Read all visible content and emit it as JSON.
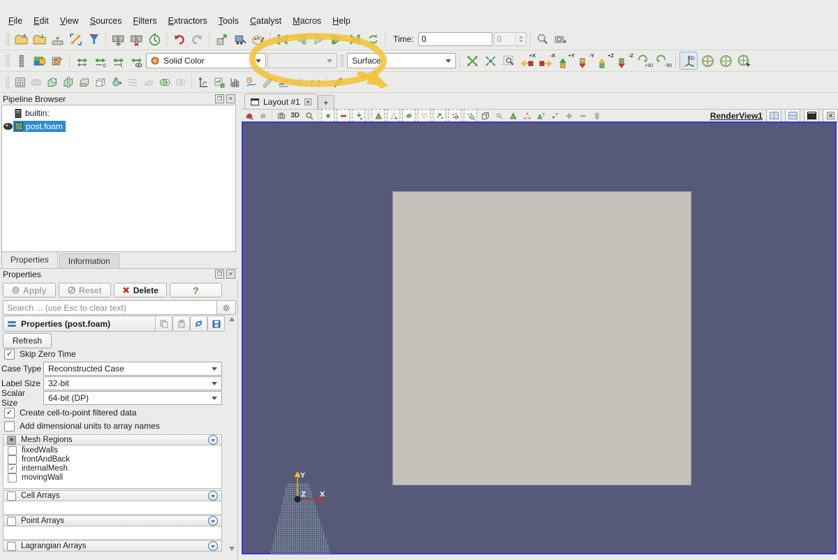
{
  "menu": {
    "items": [
      "File",
      "Edit",
      "View",
      "Sources",
      "Filters",
      "Extractors",
      "Tools",
      "Catalyst",
      "Macros",
      "Help"
    ]
  },
  "toolbar_main": {
    "icon_names": [
      "open-file-icon",
      "save-state-icon",
      "save-data-icon",
      "toggle-fullscreen-icon",
      "generate-filter-icon",
      "server-connect-icon",
      "server-disconnect-icon",
      "timer-icon",
      "undo-icon",
      "redo-icon",
      "source-link-icon",
      "data-extract-icon",
      "color-palette-icon",
      "first-frame-icon",
      "previous-frame-icon",
      "play-icon",
      "next-frame-icon",
      "last-frame-icon",
      "loop-icon",
      "zoom-inspect-icon",
      "capture-screenshot-icon"
    ],
    "time_label": "Time:",
    "time_value": "0",
    "frame_value": "0"
  },
  "toolbar_display": {
    "icon_names": [
      "toggle-color-legend-icon",
      "choose-colormap-icon",
      "edit-colormap-icon",
      "rescale-to-data-icon",
      "rescale-custom-icon",
      "rescale-temporal-icon",
      "rescale-visible-icon",
      "reset-camera-icon",
      "zoom-to-data-icon",
      "zoom-to-box-icon",
      "rotate-90-cw-icon",
      "rotate-90-ccw-icon",
      "orientation-axes-icon",
      "show-center-icon",
      "pick-center-icon",
      "reset-center-icon"
    ],
    "color_mode": "Solid Color",
    "representation": "Surface",
    "axis_views": [
      "+X",
      "-X",
      "+Y",
      "-Y",
      "+Z",
      "-Z"
    ],
    "rotate_cw": "+90",
    "rotate_ccw": "-90"
  },
  "toolbar_filters": {
    "icon_names": [
      "calculator-icon",
      "contour-icon",
      "clip-icon",
      "slice-icon",
      "threshold-icon",
      "extract-subset-icon",
      "glyph-icon",
      "stream-tracer-icon",
      "warp-icon",
      "group-datasets-icon",
      "extract-block-icon",
      "probe-location-icon",
      "plot-selection-icon",
      "histogram-icon",
      "plot-over-time-icon",
      "plot-over-line-icon",
      "plot-data-icon",
      "temporal-interpolator-icon",
      "spreadsheet-icon",
      "ruler-icon"
    ]
  },
  "view_toolbar": {
    "icon_names": [
      "edit-color-legend-icon",
      "reset-legend-icon",
      "capture-view-icon",
      "3d-toggle",
      "interactive-zoom-icon",
      "select-cells-on-icon",
      "select-points-on-icon",
      "select-cells-through-icon",
      "select-points-through-icon",
      "select-cells-polygon-icon",
      "select-points-polygon-icon",
      "select-block-icon",
      "interactive-select-cells-icon",
      "interactive-select-points-icon",
      "hover-cells-icon",
      "hover-points-icon",
      "query-cells-icon",
      "query-points-icon",
      "add-view-icon",
      "remove-view-icon",
      "delete-view-icon",
      "split-horizontal-icon",
      "split-vertical-icon",
      "maximize-view-icon",
      "close-view-icon"
    ],
    "mode_3d_label": "3D"
  },
  "pipeline": {
    "title": "Pipeline Browser",
    "items": [
      {
        "label": "builtin:",
        "selected": false
      },
      {
        "label": "post.foam",
        "selected": true
      }
    ]
  },
  "panel_tabs": {
    "properties": "Properties",
    "information": "Information"
  },
  "properties": {
    "title": "Properties",
    "apply": "Apply",
    "reset": "Reset",
    "delete": "Delete",
    "help": "?",
    "search_placeholder": "Search ... (use Esc to clear text)",
    "section_header": "Properties (post.foam)",
    "refresh": "Refresh",
    "skip_zero_time": {
      "label": "Skip Zero Time",
      "check": "✓"
    },
    "case_type": {
      "label": "Case Type",
      "value": "Reconstructed Case"
    },
    "label_size": {
      "label": "Label Size",
      "value": "32-bit"
    },
    "scalar_size": {
      "label": "Scalar Size",
      "value": "64-bit (DP)"
    },
    "cell_to_point": {
      "label": "Create cell-to-point filtered data",
      "check": "✓"
    },
    "dimensional_units": {
      "label": "Add dimensional units to array names",
      "check": ""
    },
    "mesh_regions": {
      "title": "Mesh Regions",
      "partial_check": "■",
      "items": [
        {
          "label": "fixedWalls",
          "check": ""
        },
        {
          "label": "frontAndBack",
          "check": ""
        },
        {
          "label": "internalMesh",
          "check": "✓"
        },
        {
          "label": "movingWall",
          "check": ""
        }
      ]
    },
    "cell_arrays": "Cell Arrays",
    "point_arrays": "Point Arrays",
    "lagrangian_arrays": "Lagrangian Arrays"
  },
  "layout": {
    "tab": "Layout #1",
    "new_tab": "+",
    "view_name": "RenderView1"
  },
  "viewport": {
    "background_color": "#565a78",
    "surface_color": "#c4c2ba",
    "axes": {
      "x": "X",
      "y": "Y",
      "z": "Z"
    }
  },
  "annotation": {
    "shape": "hand-drawn-ellipse",
    "highlights": "Surface",
    "color": "#f2c33e"
  }
}
